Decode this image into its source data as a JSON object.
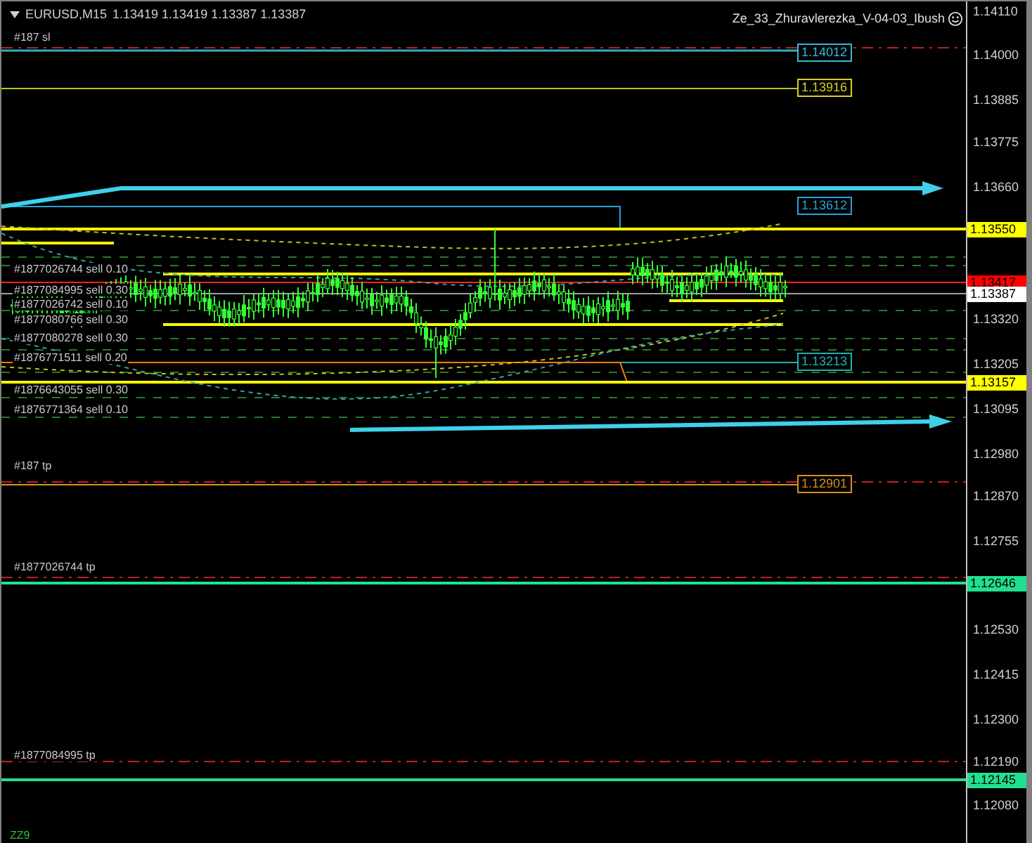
{
  "header": {
    "symbol": "EURUSD,M15",
    "quotes": "1.13419 1.13419 1.13387 1.13387",
    "expert": "Ze_33_Zhuravlerezka_V-04-03_Ibush"
  },
  "order_labels": [
    {
      "text": "#187 sl"
    },
    {
      "text": "#1877026744 sell 0.10"
    },
    {
      "text": "#1877084995 sell 0.30"
    },
    {
      "text": "#1877026742 sell 0.10"
    },
    {
      "text": "#1877080766 sell 0.30"
    },
    {
      "text": "#1877080278 sell 0.30"
    },
    {
      "text": "#1876771511 sell 0.20"
    },
    {
      "text": "#1876643055 sell 0.30"
    },
    {
      "text": "#1876771364 sell 0.10"
    },
    {
      "text": "#187 tp"
    },
    {
      "text": "#1877026744 tp"
    },
    {
      "text": "#1877084995 tp"
    }
  ],
  "line_labels": [
    {
      "text": "1.14012",
      "color": "#38b8d8"
    },
    {
      "text": "1.13916",
      "color": "#d8d020"
    },
    {
      "text": "1.13612",
      "color": "#2aa0d8"
    },
    {
      "text": "1.13213",
      "color": "#20b0b0"
    },
    {
      "text": "1.12901",
      "color": "#d89020"
    }
  ],
  "price_axis": [
    {
      "label": "1.14110",
      "kind": "tick"
    },
    {
      "label": "1.14000",
      "kind": "tick"
    },
    {
      "label": "1.13885",
      "kind": "tick"
    },
    {
      "label": "1.13775",
      "kind": "tick"
    },
    {
      "label": "1.13660",
      "kind": "tick"
    },
    {
      "label": "1.13550",
      "kind": "marker",
      "color": "#ffff00"
    },
    {
      "label": "1.13417",
      "kind": "marker",
      "color": "#ff0000"
    },
    {
      "label": "1.13387",
      "kind": "marker",
      "color": "#ffffff"
    },
    {
      "label": "1.13320",
      "kind": "tick"
    },
    {
      "label": "1.13205",
      "kind": "tick"
    },
    {
      "label": "1.13157",
      "kind": "marker",
      "color": "#ffff00"
    },
    {
      "label": "1.13095",
      "kind": "tick"
    },
    {
      "label": "1.12980",
      "kind": "tick"
    },
    {
      "label": "1.12870",
      "kind": "tick"
    },
    {
      "label": "1.12755",
      "kind": "tick"
    },
    {
      "label": "1.12646",
      "kind": "marker",
      "color": "#20e090"
    },
    {
      "label": "1.12530",
      "kind": "tick"
    },
    {
      "label": "1.12415",
      "kind": "tick"
    },
    {
      "label": "1.12300",
      "kind": "tick"
    },
    {
      "label": "1.12190",
      "kind": "tick"
    },
    {
      "label": "1.12145",
      "kind": "marker",
      "color": "#20e090"
    },
    {
      "label": "1.12080",
      "kind": "tick"
    }
  ],
  "footer": {
    "text": "ZZ9"
  }
}
